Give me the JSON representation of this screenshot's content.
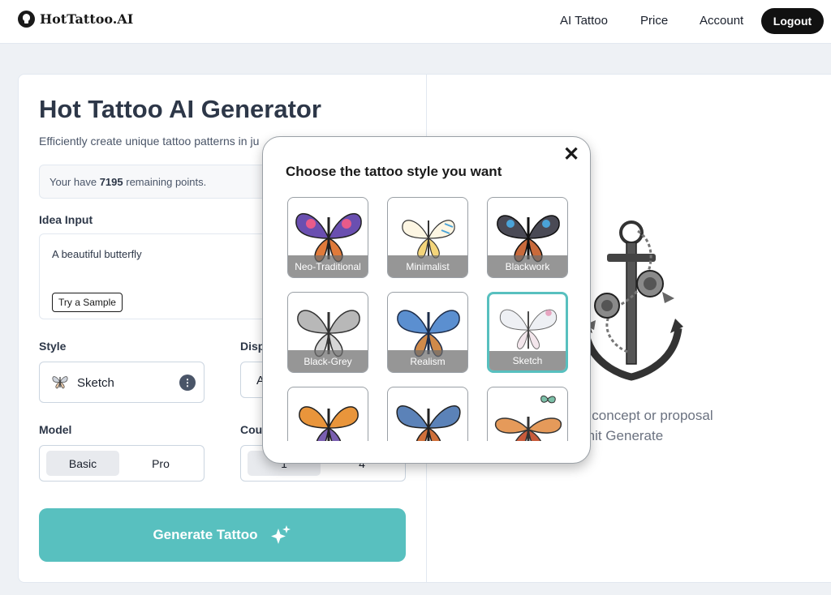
{
  "nav": {
    "logo_text": "HotTattoo.AI",
    "links": [
      "AI Tattoo",
      "Price",
      "Account"
    ],
    "logout_label": "Logout"
  },
  "generator": {
    "title": "Hot Tattoo AI Generator",
    "subtitle_visible": "Efficiently create unique tattoo patterns in ju",
    "points_prefix": "Your have",
    "points_value": "7195",
    "points_suffix": "remaining points.",
    "idea_label": "Idea Input",
    "idea_value": "A beautiful butterfly",
    "sample_button": "Try a Sample",
    "style_label": "Style",
    "style_value": "Sketch",
    "display_label_visible": "Disp",
    "display_value_visible": "A",
    "model_label": "Model",
    "model_options": [
      "Basic",
      "Pro"
    ],
    "model_selected": "Basic",
    "count_label_visible": "Cou",
    "count_options": [
      "1",
      "4"
    ],
    "count_selected": "1",
    "generate_button": "Generate Tattoo"
  },
  "preview": {
    "message_line1": "our concept or proposal",
    "message_line2": "en hit Generate"
  },
  "modal": {
    "title": "Choose the tattoo style you want",
    "close_icon": "close-icon",
    "styles": [
      {
        "label": "Neo-Traditional",
        "selected": false
      },
      {
        "label": "Minimalist",
        "selected": false
      },
      {
        "label": "Blackwork",
        "selected": false
      },
      {
        "label": "Black-Grey",
        "selected": false
      },
      {
        "label": "Realism",
        "selected": false
      },
      {
        "label": "Sketch",
        "selected": true
      },
      {
        "label": "",
        "selected": false
      },
      {
        "label": "",
        "selected": false
      },
      {
        "label": "",
        "selected": false
      }
    ]
  },
  "colors": {
    "accent": "#58c0bf",
    "nav_button": "#111111",
    "background": "#eef1f5"
  }
}
